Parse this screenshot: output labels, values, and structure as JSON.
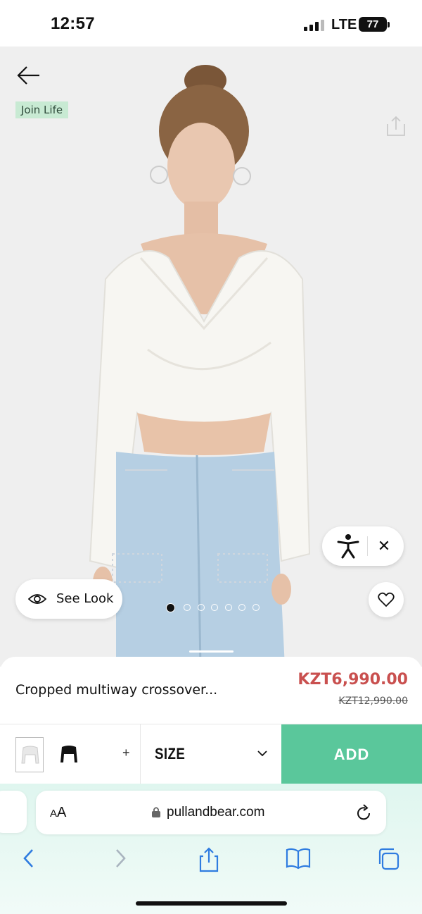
{
  "status_bar": {
    "time": "12:57",
    "network": "LTE",
    "battery": "77"
  },
  "hero": {
    "tag": "Join Life",
    "see_look_label": "See Look",
    "carousel": {
      "total": 7,
      "active_index": 0
    }
  },
  "product": {
    "name": "Cropped multiway crossover...",
    "price": "KZT6,990.00",
    "old_price": "KZT12,990.00"
  },
  "actions": {
    "plus_label": "+",
    "size_label": "SIZE",
    "add_label": "ADD"
  },
  "browser": {
    "text_size_small": "A",
    "text_size_large": "A",
    "url": "pullandbear.com"
  },
  "colors": {
    "price": "#c9504f",
    "add_button": "#5ac79b",
    "tag_bg": "#c8ead3",
    "browser_accent": "#2f7ce0"
  },
  "icons": {
    "back": "arrow-left-icon",
    "share": "share-icon",
    "accessibility": "accessibility-person-icon",
    "close": "close-icon",
    "eye": "eye-icon",
    "heart": "heart-icon",
    "chevron": "chevron-down-icon",
    "lock": "lock-icon",
    "reload": "reload-icon"
  }
}
